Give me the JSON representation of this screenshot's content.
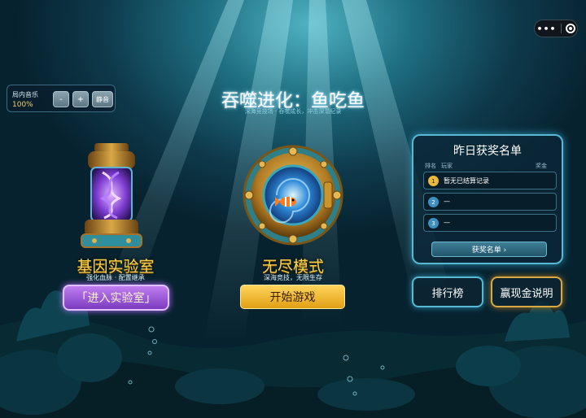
{
  "header": {
    "title": "吞噬进化：鱼吃鱼",
    "subtitle": "深海竞技场 · 吞噬成长，冲击深潜纪录"
  },
  "capsule": {
    "more_icon": "•••",
    "close_icon": "target-circle"
  },
  "music": {
    "label": "局内音乐",
    "volume": "100%",
    "minus": "-",
    "plus": "+",
    "mute": "静音"
  },
  "lab": {
    "title": "基因实验室",
    "caption": "强化血脉 · 配置继承",
    "button": "「进入实验室」"
  },
  "endless": {
    "title": "无尽模式",
    "caption": "深海竞技，无限生存",
    "button": "开始游戏"
  },
  "winners": {
    "title": "昨日获奖名单",
    "col_rank": "排名",
    "col_player": "玩家",
    "col_prize": "奖金",
    "rows": [
      {
        "rank": "1",
        "text": "暂无已结算记录"
      },
      {
        "rank": "2",
        "text": "—"
      },
      {
        "rank": "3",
        "text": "—"
      }
    ],
    "list_button": "获奖名单 ›"
  },
  "bottom": {
    "leaderboard": "排行榜",
    "cash_rules": "赢现金说明"
  },
  "colors": {
    "gold": "#f8d24a",
    "purple_button": "#9b57d8",
    "panel_border": "#59b8d4",
    "rank1": "#e9b93a",
    "rank2": "#3e8fc0",
    "rank3": "#3e8fc0"
  }
}
